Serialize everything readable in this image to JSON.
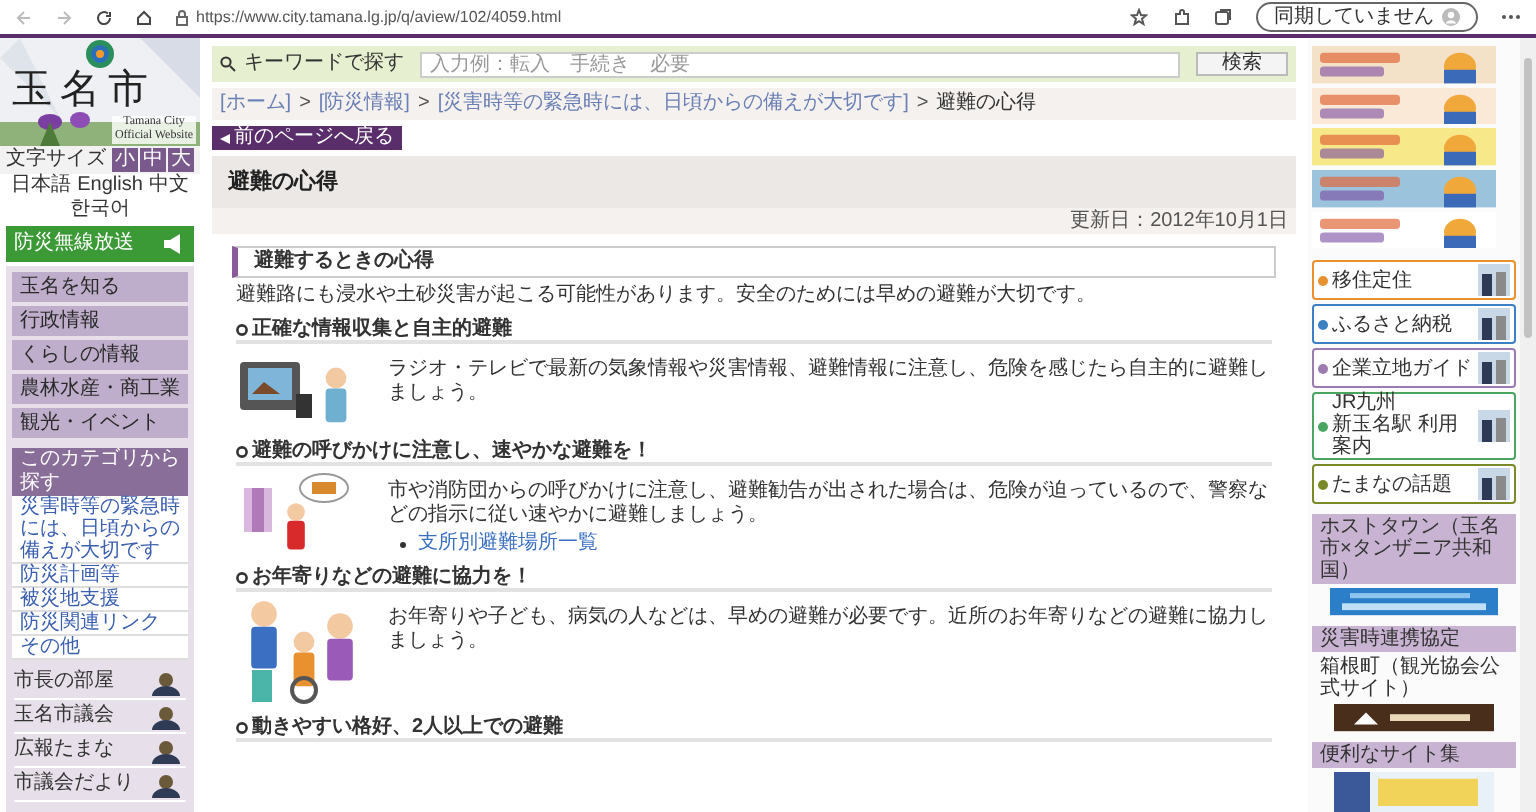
{
  "browser": {
    "url": "https://www.city.tamana.lg.jp/q/aview/102/4059.html",
    "sync_button": "同期していません"
  },
  "sidebar": {
    "logo": {
      "kind": "picture",
      "title": "玉名市",
      "subtitle": "Tamana City Official Website"
    },
    "font_size": {
      "label": "文字サイズ",
      "options": [
        "小",
        "中",
        "大"
      ]
    },
    "languages": [
      "日本語",
      "English",
      "中文",
      "한국어"
    ],
    "radio_button": "防災無線放送",
    "nav": [
      "玉名を知る",
      "行政情報",
      "くらしの情報",
      "農林水産・商工業",
      "観光・イベント"
    ],
    "category": {
      "heading": "このカテゴリから探す",
      "links": [
        "災害時等の緊急時には、日頃からの備えが大切です",
        "防災計画等",
        "被災地支援",
        "防災関連リンク",
        "その他"
      ]
    },
    "bottom_links": [
      "市長の部屋",
      "玉名市議会",
      "広報たまな",
      "市議会だより"
    ]
  },
  "search": {
    "label": "キーワードで探す",
    "placeholder": "入力例：転入　手続き　必要",
    "button": "検索"
  },
  "breadcrumb": [
    {
      "label": "[ホーム]",
      "kind": "link"
    },
    {
      "separator": ">",
      "label": "[防災情報]",
      "kind": "link"
    },
    {
      "separator": ">",
      "label": "[災害時等の緊急時には、日頃からの備えが大切です]",
      "kind": "link"
    },
    {
      "separator": ">",
      "label": "避難の心得",
      "kind": "current"
    }
  ],
  "back_button": "前のページへ戻る",
  "page": {
    "title": "避難の心得",
    "updated": "更新日：2012年10月1日",
    "section": "避難するときの心得",
    "intro": "避難路にも浸水や土砂災害が起こる可能性があります。安全のためには早めの避難が大切です。",
    "topics": [
      {
        "heading": "正確な情報収集と自主的避難",
        "text": "ラジオ・テレビで最新の気象情報や災害情報、避難情報に注意し、危険を感じたら自主的に避難しましょう。",
        "kind": "picture"
      },
      {
        "heading": "避難の呼びかけに注意し、速やかな避難を！",
        "text": "市や消防団からの呼びかけに注意し、避難勧告が出された場合は、危険が迫っているので、警察などの指示に従い速やかに避難しましょう。",
        "links": [
          "支所別避難場所一覧"
        ],
        "kind": "picture"
      },
      {
        "heading": "お年寄りなどの避難に協力を！",
        "text": "お年寄りや子ども、病気の人などは、早めの避難が必要です。近所のお年寄りなどの避難に協力しましょう。",
        "kind": "picture"
      },
      {
        "heading": "動きやすい格好、2人以上での避難"
      }
    ]
  },
  "right": {
    "links": [
      {
        "label": "移住定住",
        "color": "#e8912f"
      },
      {
        "label": "ふるさと納税",
        "color": "#3b7fc4"
      },
      {
        "label": "企業立地ガイド",
        "color": "#9b7bb0"
      },
      {
        "sublabel": "JR九州",
        "label": "新玉名駅 利用案内",
        "color": "#4aa562"
      },
      {
        "label": "たまなの話題",
        "color": "#7a8a2a"
      }
    ],
    "host_town": {
      "heading": "ホストタウン（玉名市×タンザニア共和国）"
    },
    "agreement": {
      "heading": "災害時連携協定",
      "caption": "箱根町（観光協会公式サイト）"
    },
    "useful": {
      "heading": "便利なサイト集"
    }
  }
}
